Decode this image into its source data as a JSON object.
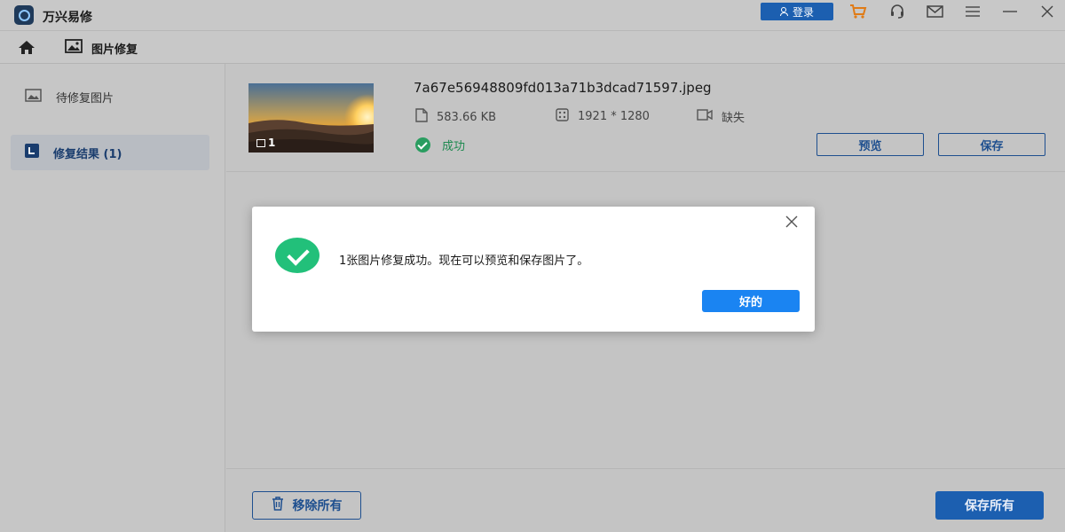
{
  "app": {
    "title": "万兴易修",
    "brand_color": "#1c5fb0"
  },
  "titlebar": {
    "login_label": "登录",
    "icons": [
      "user-icon",
      "cart-icon",
      "headset-icon",
      "mail-icon",
      "menu-icon",
      "minimize-icon",
      "close-icon"
    ]
  },
  "nav": {
    "home_icon": "home-icon",
    "tab_label": "图片修复"
  },
  "sidebar": {
    "items": [
      {
        "label": "待修复图片",
        "icon": "image-icon",
        "active": false
      },
      {
        "label": "修复结果 (1)",
        "icon": "result-icon",
        "active": true
      }
    ]
  },
  "file": {
    "name": "7a67e56948809fd013a71b3dcad71597.jpeg",
    "image_count": "1",
    "size": "583.66  KB",
    "resolution": "1921 * 1280",
    "video_status": "缺失",
    "status": "成功",
    "preview_label": "预览",
    "save_label": "保存",
    "status_color": "#1e8a50"
  },
  "bottom": {
    "remove_all_label": "移除所有",
    "save_all_label": "保存所有"
  },
  "dialog": {
    "message": "1张图片修复成功。现在可以预览和保存图片了。",
    "ok_label": "好的",
    "accent": "#1a84f2",
    "success_color": "#22c07a"
  }
}
